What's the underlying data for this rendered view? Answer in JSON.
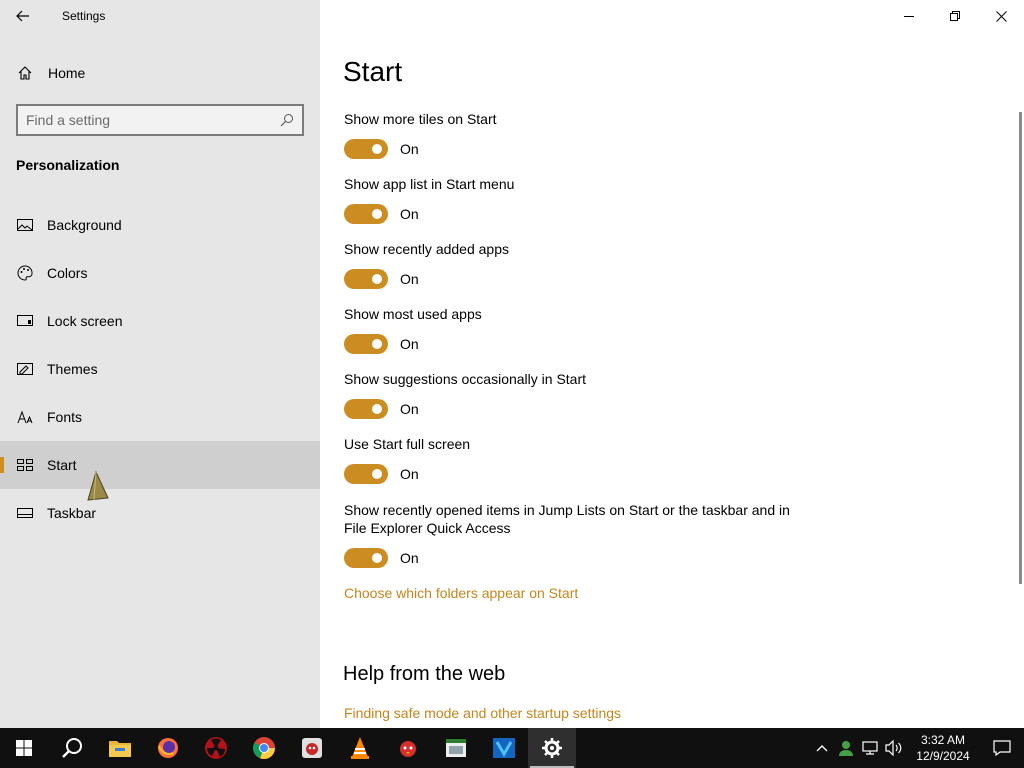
{
  "window": {
    "title": "Settings"
  },
  "sidebar": {
    "home_label": "Home",
    "search_placeholder": "Find a setting",
    "section_label": "Personalization",
    "items": [
      {
        "label": "Background",
        "icon": "picture-icon"
      },
      {
        "label": "Colors",
        "icon": "palette-icon"
      },
      {
        "label": "Lock screen",
        "icon": "lock-screen-icon"
      },
      {
        "label": "Themes",
        "icon": "themes-icon"
      },
      {
        "label": "Fonts",
        "icon": "fonts-icon"
      },
      {
        "label": "Start",
        "icon": "start-icon",
        "selected": true
      },
      {
        "label": "Taskbar",
        "icon": "taskbar-icon"
      }
    ]
  },
  "main": {
    "title": "Start",
    "settings": [
      {
        "label": "Show more tiles on Start",
        "state": "On"
      },
      {
        "label": "Show app list in Start menu",
        "state": "On"
      },
      {
        "label": "Show recently added apps",
        "state": "On"
      },
      {
        "label": "Show most used apps",
        "state": "On"
      },
      {
        "label": "Show suggestions occasionally in Start",
        "state": "On"
      },
      {
        "label": "Use Start full screen",
        "state": "On"
      },
      {
        "label": "Show recently opened items in Jump Lists on Start or the taskbar and in File Explorer Quick Access",
        "state": "On"
      }
    ],
    "folders_link": "Choose which folders appear on Start",
    "help_title": "Help from the web",
    "help_link": "Finding safe mode and other startup settings"
  },
  "taskbar": {
    "time": "3:32 AM",
    "date": "12/9/2024"
  },
  "colors": {
    "accent": "#cb8d22",
    "link": "#c2861f",
    "sidebar_bg": "#e6e6e6",
    "taskbar_bg": "#101010"
  }
}
